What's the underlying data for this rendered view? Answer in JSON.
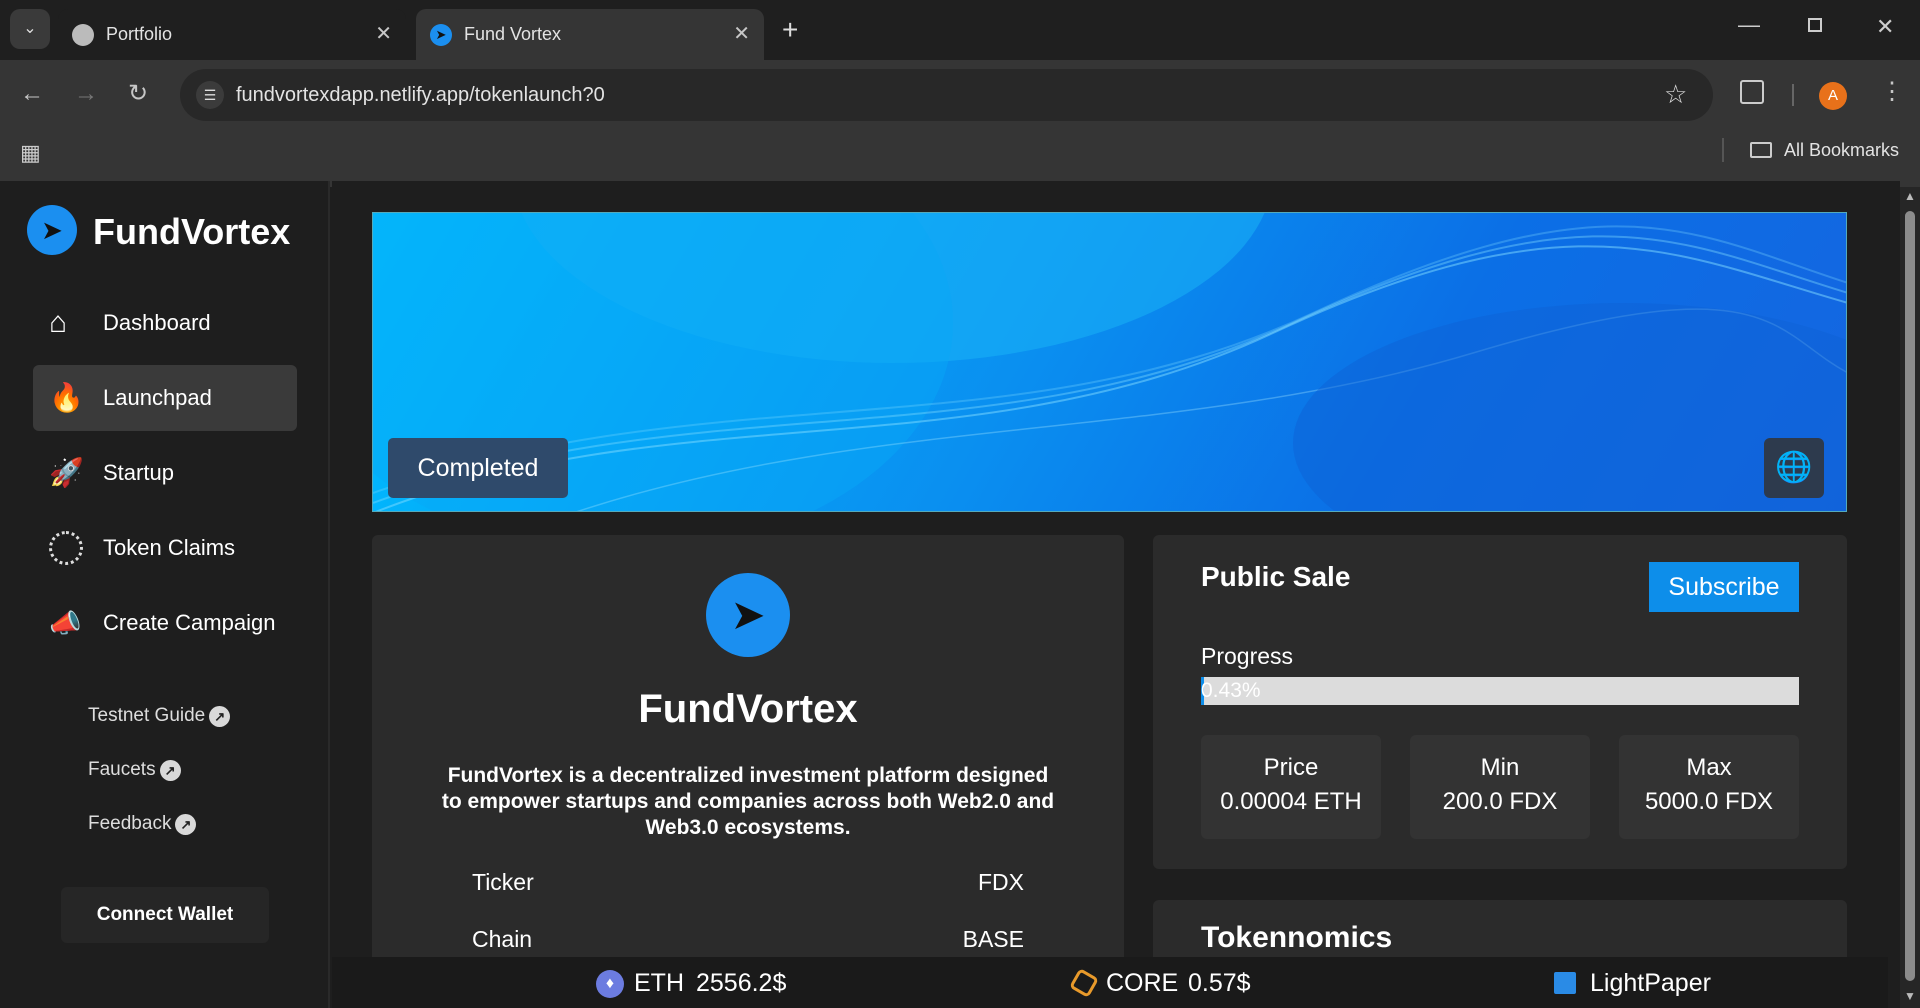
{
  "browser": {
    "tabs": [
      {
        "title": "Portfolio",
        "active": false
      },
      {
        "title": "Fund Vortex",
        "active": true
      }
    ],
    "url": "fundvortexdapp.netlify.app/tokenlaunch?0",
    "profile_initial": "A",
    "bookmarks_label": "All Bookmarks"
  },
  "sidebar": {
    "brand": "FundVortex",
    "nav": [
      {
        "label": "Dashboard",
        "icon": "home-icon"
      },
      {
        "label": "Launchpad",
        "icon": "flame-icon"
      },
      {
        "label": "Startup",
        "icon": "rocket-icon"
      },
      {
        "label": "Token Claims",
        "icon": "coins-icon"
      },
      {
        "label": "Create Campaign",
        "icon": "megaphone-icon"
      }
    ],
    "links": [
      {
        "label": "Testnet Guide"
      },
      {
        "label": "Faucets"
      },
      {
        "label": "Feedback"
      }
    ],
    "connect_wallet": "Connect Wallet"
  },
  "banner": {
    "status": "Completed"
  },
  "project": {
    "name": "FundVortex",
    "description": "FundVortex is a decentralized investment platform designed to empower startups and companies across both Web2.0 and Web3.0 ecosystems.",
    "details": [
      {
        "key": "Ticker",
        "value": "FDX"
      },
      {
        "key": "Chain",
        "value": "BASE"
      }
    ]
  },
  "sale": {
    "title": "Public Sale",
    "subscribe": "Subscribe",
    "progress_label": "Progress",
    "progress_text": "0.43%",
    "progress_value": 0.43,
    "stats": [
      {
        "label": "Price",
        "value": "0.00004 ETH"
      },
      {
        "label": "Min",
        "value": "200.0 FDX"
      },
      {
        "label": "Max",
        "value": "5000.0 FDX"
      }
    ]
  },
  "tokenomics": {
    "title": "Tokennomics"
  },
  "footer": {
    "eth_label": "ETH",
    "eth_price": "2556.2$",
    "core_label": "CORE",
    "core_price": "0.57$",
    "lightpaper": "LightPaper"
  },
  "colors": {
    "accent": "#0a8ff0",
    "subscribe_bg": "#0d8eea",
    "active_nav": "#3a3a3a",
    "profile": "#e8711a"
  }
}
